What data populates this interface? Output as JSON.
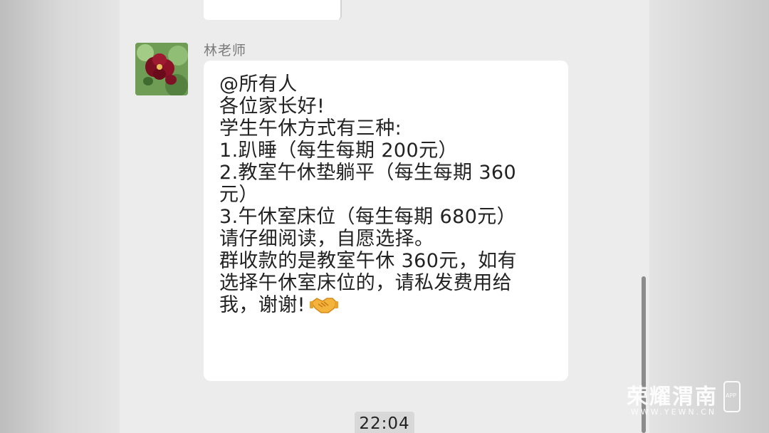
{
  "chat": {
    "sender_name": "林老师",
    "message_lines": [
      "@所有人",
      "各位家长好!",
      "学生午休方式有三种:",
      "1.趴睡（每生每期 200元）",
      "2.教室午休垫躺平（每生每期 360",
      "元）",
      "3.午休室床位（每生每期 680元）",
      "请仔细阅读，自愿选择。",
      "群收款的是教室午休 360元，如有",
      "选择午休室床位的，请私发费用给",
      "我，谢谢!"
    ],
    "emoji_icon": "handshake-icon",
    "timestamp": "22:04"
  },
  "watermark": {
    "brand": "荣耀渭南",
    "url": "WWW.YEWN.CN",
    "app_badge": "APP"
  },
  "colors": {
    "bubble": "#ffffff",
    "chat_background": "#ececec",
    "text": "#222222",
    "sender_name": "#7a7a7a"
  }
}
